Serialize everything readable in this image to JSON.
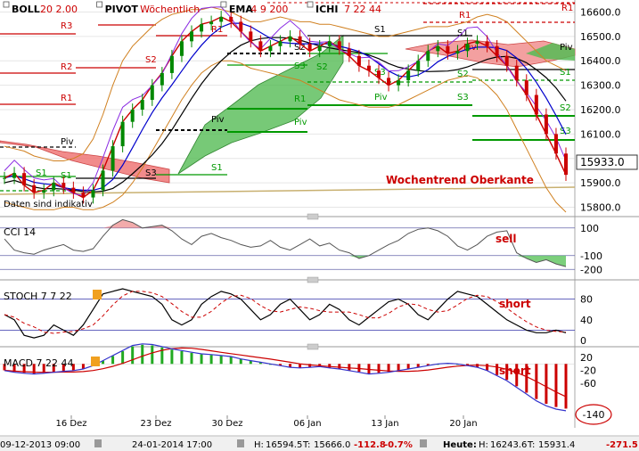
{
  "toolbar": {
    "items": [
      {
        "name": "BOLL",
        "params": "20 2.00",
        "colors": [
          "#cc0000",
          "#cc0000"
        ]
      },
      {
        "name": "PIVOT",
        "params": "Wöchentlich",
        "colors": [
          "#000000",
          "#000000"
        ]
      },
      {
        "name": "EMA",
        "params": "4 9 200",
        "colors": [
          "#000000",
          "#cc0000"
        ]
      },
      {
        "name": "ICHI",
        "params": "7 22 44",
        "colors": [
          "#000000",
          "#cc0000"
        ]
      }
    ]
  },
  "colors": {
    "candle_up": "#008800",
    "candle_down": "#cc0000",
    "pivot_support": "#009900",
    "pivot_resist": "#cc0000",
    "pivot": "#000000",
    "cloud_green": "#55bb55",
    "cloud_red": "#ee7777",
    "boll_upper": "#d08020",
    "ema_fast": "#cc0000",
    "ema_mid": "#0000cc",
    "ema_slow": "#c8a060",
    "annot": "#cc0000",
    "panel_sep": "#888888"
  },
  "main_panel": {
    "y_ticks": [
      "16600.0",
      "16500.0",
      "16400.0",
      "16300.0",
      "16200.0",
      "16100.0",
      "16000.0",
      "15900.0",
      "15800.0"
    ],
    "last_price": "15933.0",
    "note": "Daten sind indikativ",
    "annotation": "Wochentrend Oberkante",
    "pivot_labels": [
      "R3",
      "R2",
      "R1",
      "Piv",
      "S1",
      "S2",
      "S3",
      "R1",
      "Piv",
      "S1",
      "S2",
      "S3",
      "R1",
      "Piv",
      "S1",
      "S2",
      "S3",
      "Piv",
      "S1",
      "S2",
      "S3",
      "R1",
      "Piv",
      "S1",
      "S2",
      "S3",
      "S1",
      "Piv",
      "R1",
      "R3"
    ]
  },
  "cci_panel": {
    "title": "CCI",
    "period": "14",
    "signal": "sell",
    "y_ticks": [
      "100",
      "-100",
      "-200"
    ]
  },
  "stoch_panel": {
    "title": "STOCH",
    "params": "7 7 22",
    "signal": "short",
    "y_ticks": [
      "80",
      "40",
      "0"
    ]
  },
  "macd_panel": {
    "title": "MACD",
    "params": "7 22 44",
    "signal": "short",
    "y_ticks": [
      "20",
      "-20",
      "-60"
    ],
    "last_value": "-140"
  },
  "x_ticks": [
    "16 Dez",
    "23 Dez",
    "30 Dez",
    "06 Jan",
    "13 Jan",
    "20 Jan"
  ],
  "status_bar": {
    "start": "09-12-2013 09:00",
    "end": "24-01-2014 17:00",
    "high_label": "H:",
    "high": "16594.5",
    "low_label": "T:",
    "low": "15666.0",
    "change": "-112.8",
    "change_pct": "-0.7%",
    "today_label": "Heute:",
    "today_high_label": "H:",
    "today_high": "16243.6",
    "today_low_label": "T:",
    "today_low": "15931.4",
    "today_change": "-271.5"
  },
  "chart_data": {
    "type": "line",
    "x_categories": [
      "16 Dez",
      "23 Dez",
      "30 Dez",
      "06 Jan",
      "13 Jan",
      "20 Jan"
    ],
    "y_range": [
      15780,
      16620
    ],
    "close_series": [
      15920,
      15940,
      15890,
      15860,
      15870,
      15900,
      15880,
      15860,
      15840,
      15870,
      15950,
      16050,
      16150,
      16200,
      16240,
      16300,
      16350,
      16420,
      16480,
      16520,
      16550,
      16560,
      16580,
      16560,
      16520,
      16480,
      16440,
      16460,
      16480,
      16500,
      16470,
      16440,
      16460,
      16480,
      16450,
      16420,
      16380,
      16360,
      16330,
      16300,
      16320,
      16360,
      16400,
      16440,
      16460,
      16430,
      16440,
      16470,
      16480,
      16460,
      16420,
      16380,
      16320,
      16260,
      16180,
      16100,
      16020,
      15933
    ],
    "boll_upper": [
      16050,
      16040,
      16030,
      16010,
      16000,
      15990,
      15990,
      16000,
      16020,
      16080,
      16180,
      16300,
      16400,
      16460,
      16500,
      16540,
      16570,
      16590,
      16600,
      16610,
      16610,
      16620,
      16610,
      16600,
      16580,
      16560,
      16560,
      16570,
      16580,
      16570,
      16560,
      16560,
      16550,
      16550,
      16540,
      16530,
      16520,
      16510,
      16500,
      16500,
      16510,
      16520,
      16530,
      16540,
      16540,
      16540,
      16550,
      16560,
      16580,
      16590,
      16580,
      16560,
      16520,
      16480,
      16440,
      16400,
      16380,
      16360
    ],
    "boll_lower": [
      15820,
      15810,
      15800,
      15790,
      15790,
      15790,
      15800,
      15800,
      15790,
      15790,
      15800,
      15820,
      15850,
      15900,
      15960,
      16030,
      16100,
      16170,
      16240,
      16300,
      16350,
      16380,
      16400,
      16400,
      16390,
      16370,
      16360,
      16350,
      16340,
      16330,
      16320,
      16300,
      16280,
      16260,
      16240,
      16230,
      16220,
      16210,
      16210,
      16210,
      16220,
      16240,
      16260,
      16280,
      16300,
      16320,
      16330,
      16340,
      16330,
      16300,
      16260,
      16200,
      16120,
      16040,
      15960,
      15880,
      15820,
      15780
    ],
    "cci_series": [
      20,
      -60,
      -80,
      -90,
      -60,
      -40,
      -20,
      -60,
      -70,
      -50,
      40,
      120,
      160,
      140,
      100,
      110,
      120,
      80,
      20,
      -20,
      40,
      60,
      30,
      10,
      -20,
      -40,
      -30,
      10,
      -40,
      -60,
      -20,
      20,
      -30,
      -10,
      -60,
      -80,
      -120,
      -100,
      -60,
      -20,
      10,
      60,
      90,
      100,
      80,
      40,
      -30,
      -60,
      -20,
      40,
      70,
      80,
      -80,
      -120,
      -150,
      -130,
      -160,
      -180
    ],
    "stoch_series": [
      50,
      40,
      10,
      5,
      10,
      30,
      20,
      10,
      30,
      60,
      90,
      95,
      100,
      95,
      90,
      85,
      70,
      40,
      30,
      40,
      70,
      85,
      95,
      90,
      80,
      60,
      40,
      50,
      70,
      80,
      60,
      40,
      50,
      70,
      60,
      40,
      30,
      45,
      60,
      75,
      80,
      70,
      50,
      40,
      60,
      80,
      95,
      90,
      85,
      70,
      55,
      40,
      30,
      20,
      15,
      15,
      20,
      15
    ],
    "macd_series": [
      -20,
      -25,
      -28,
      -30,
      -28,
      -25,
      -22,
      -20,
      -15,
      -5,
      10,
      25,
      40,
      55,
      60,
      58,
      52,
      45,
      40,
      35,
      30,
      28,
      25,
      22,
      15,
      10,
      5,
      0,
      -5,
      -10,
      -12,
      -10,
      -8,
      -12,
      -15,
      -20,
      -25,
      -30,
      -28,
      -25,
      -20,
      -15,
      -10,
      -5,
      0,
      2,
      0,
      -5,
      -10,
      -20,
      -35,
      -50,
      -70,
      -90,
      -110,
      -125,
      -135,
      -140
    ]
  }
}
